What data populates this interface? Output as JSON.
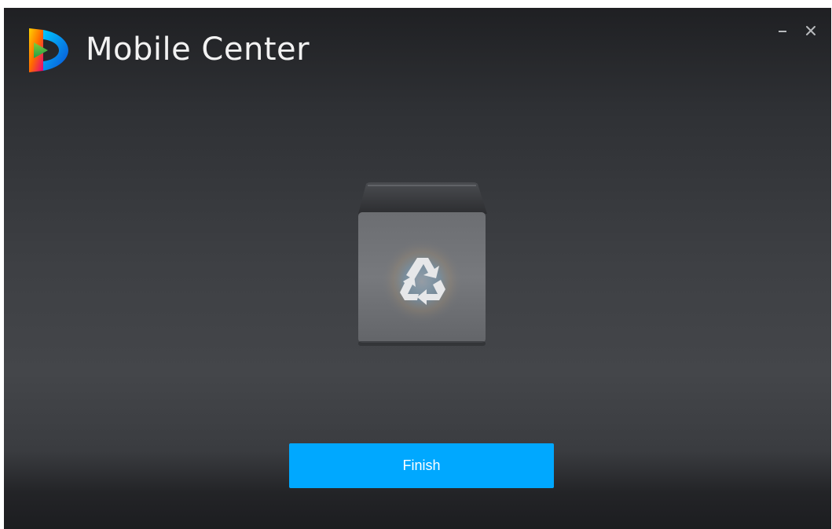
{
  "window": {
    "title": "Mobile Center",
    "controls": {
      "minimize_icon": "minimize-icon",
      "close_icon": "close-icon"
    }
  },
  "main": {
    "illustration_icon": "recycle-bin-icon",
    "finish_label": "Finish"
  },
  "colors": {
    "accent": "#00a8ff",
    "title_text": "#f2f2f2",
    "background_dark": "#1f2023",
    "background_mid": "#44464a"
  }
}
